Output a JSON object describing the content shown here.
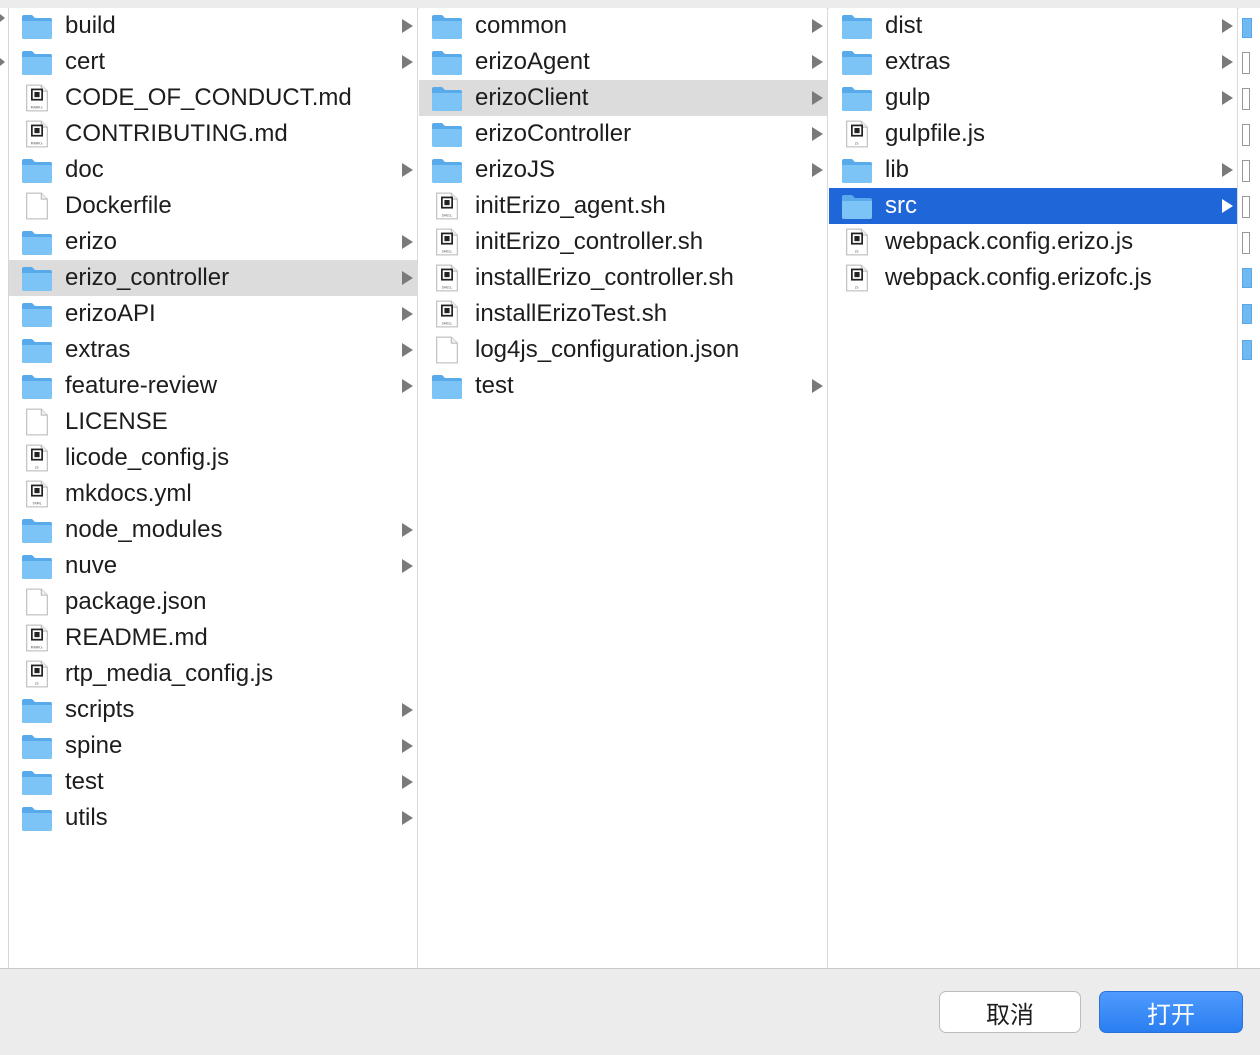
{
  "columns": [
    {
      "items": [
        {
          "label": "build",
          "type": "folder",
          "has_children": true,
          "selected": ""
        },
        {
          "label": "cert",
          "type": "folder",
          "has_children": true,
          "selected": ""
        },
        {
          "label": "CODE_OF_CONDUCT.md",
          "type": "markdown",
          "has_children": false,
          "selected": ""
        },
        {
          "label": "CONTRIBUTING.md",
          "type": "markdown",
          "has_children": false,
          "selected": ""
        },
        {
          "label": "doc",
          "type": "folder",
          "has_children": true,
          "selected": ""
        },
        {
          "label": "Dockerfile",
          "type": "blank",
          "has_children": false,
          "selected": ""
        },
        {
          "label": "erizo",
          "type": "folder",
          "has_children": true,
          "selected": ""
        },
        {
          "label": "erizo_controller",
          "type": "folder",
          "has_children": true,
          "selected": "gray"
        },
        {
          "label": "erizoAPI",
          "type": "folder",
          "has_children": true,
          "selected": ""
        },
        {
          "label": "extras",
          "type": "folder",
          "has_children": true,
          "selected": ""
        },
        {
          "label": "feature-review",
          "type": "folder",
          "has_children": true,
          "selected": ""
        },
        {
          "label": "LICENSE",
          "type": "blank",
          "has_children": false,
          "selected": ""
        },
        {
          "label": "licode_config.js",
          "type": "js",
          "has_children": false,
          "selected": ""
        },
        {
          "label": "mkdocs.yml",
          "type": "yaml",
          "has_children": false,
          "selected": ""
        },
        {
          "label": "node_modules",
          "type": "folder",
          "has_children": true,
          "selected": ""
        },
        {
          "label": "nuve",
          "type": "folder",
          "has_children": true,
          "selected": ""
        },
        {
          "label": "package.json",
          "type": "blank",
          "has_children": false,
          "selected": ""
        },
        {
          "label": "README.md",
          "type": "markdown",
          "has_children": false,
          "selected": ""
        },
        {
          "label": "rtp_media_config.js",
          "type": "js",
          "has_children": false,
          "selected": ""
        },
        {
          "label": "scripts",
          "type": "folder",
          "has_children": true,
          "selected": ""
        },
        {
          "label": "spine",
          "type": "folder",
          "has_children": true,
          "selected": ""
        },
        {
          "label": "test",
          "type": "folder",
          "has_children": true,
          "selected": ""
        },
        {
          "label": "utils",
          "type": "folder",
          "has_children": true,
          "selected": ""
        }
      ]
    },
    {
      "items": [
        {
          "label": "common",
          "type": "folder",
          "has_children": true,
          "selected": ""
        },
        {
          "label": "erizoAgent",
          "type": "folder",
          "has_children": true,
          "selected": ""
        },
        {
          "label": "erizoClient",
          "type": "folder",
          "has_children": true,
          "selected": "gray"
        },
        {
          "label": "erizoController",
          "type": "folder",
          "has_children": true,
          "selected": ""
        },
        {
          "label": "erizoJS",
          "type": "folder",
          "has_children": true,
          "selected": ""
        },
        {
          "label": "initErizo_agent.sh",
          "type": "shell",
          "has_children": false,
          "selected": ""
        },
        {
          "label": "initErizo_controller.sh",
          "type": "shell",
          "has_children": false,
          "selected": ""
        },
        {
          "label": "installErizo_controller.sh",
          "type": "shell",
          "has_children": false,
          "selected": ""
        },
        {
          "label": "installErizoTest.sh",
          "type": "shell",
          "has_children": false,
          "selected": ""
        },
        {
          "label": "log4js_configuration.json",
          "type": "blank",
          "has_children": false,
          "selected": ""
        },
        {
          "label": "test",
          "type": "folder",
          "has_children": true,
          "selected": ""
        }
      ]
    },
    {
      "items": [
        {
          "label": "dist",
          "type": "folder",
          "has_children": true,
          "selected": ""
        },
        {
          "label": "extras",
          "type": "folder",
          "has_children": true,
          "selected": ""
        },
        {
          "label": "gulp",
          "type": "folder",
          "has_children": true,
          "selected": ""
        },
        {
          "label": "gulpfile.js",
          "type": "js",
          "has_children": false,
          "selected": ""
        },
        {
          "label": "lib",
          "type": "folder",
          "has_children": true,
          "selected": ""
        },
        {
          "label": "src",
          "type": "folder",
          "has_children": true,
          "selected": "blue"
        },
        {
          "label": "webpack.config.erizo.js",
          "type": "js",
          "has_children": false,
          "selected": ""
        },
        {
          "label": "webpack.config.erizofc.js",
          "type": "js",
          "has_children": false,
          "selected": ""
        }
      ]
    }
  ],
  "icon_tags": {
    "markdown": "MARK↓",
    "js": "JS",
    "yaml": "YAML",
    "shell": "SHELL"
  },
  "buttons": {
    "cancel": "取消",
    "open": "打开"
  },
  "colors": {
    "accent": "#1f66d9",
    "folder": "#6fbaf2",
    "row_gray": "#dcdcdc"
  }
}
